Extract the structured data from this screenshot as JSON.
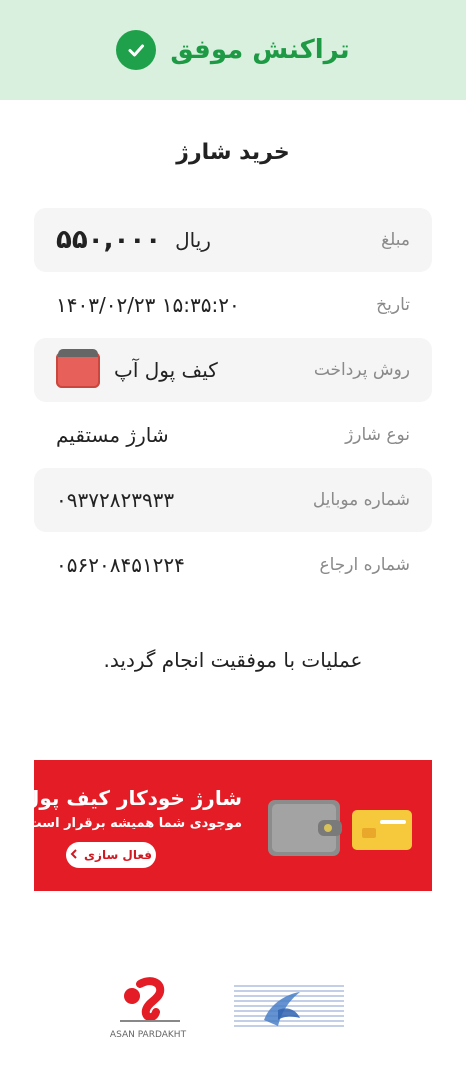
{
  "header": {
    "title": "تراکنش موفق"
  },
  "page_title": "خرید شارژ",
  "details": {
    "amount": {
      "label": "مبلغ",
      "value": "۵۵۰,۰۰۰",
      "unit": "ریال"
    },
    "date": {
      "label": "تاریخ",
      "value": "۱۵:۳۵:۲۰ ۱۴۰۳/۰۲/۲۳"
    },
    "payment": {
      "label": "روش پرداخت",
      "value": "کیف پول آپ",
      "icon": "wallet-icon"
    },
    "charge_type": {
      "label": "نوع شارژ",
      "value": "شارژ مستقیم"
    },
    "mobile": {
      "label": "شماره موبایل",
      "value": "۰۹۳۷۲۸۲۳۹۳۳"
    },
    "reference": {
      "label": "شماره ارجاع",
      "value": "۰۵۶۲۰۸۴۵۱۲۲۴"
    }
  },
  "message": "عملیات با موفقیت انجام گردید.",
  "banner": {
    "title": "شارژ خودکار کیف پول",
    "subtitle": "موجودی شما همیشه برقرار است",
    "button": "فعال سازی"
  },
  "footer": {
    "logo_left_text": "ASAN PARDAKHT"
  },
  "colors": {
    "success": "#1ea14a",
    "header_bg": "#d9f0df",
    "banner_bg": "#e31c25"
  }
}
